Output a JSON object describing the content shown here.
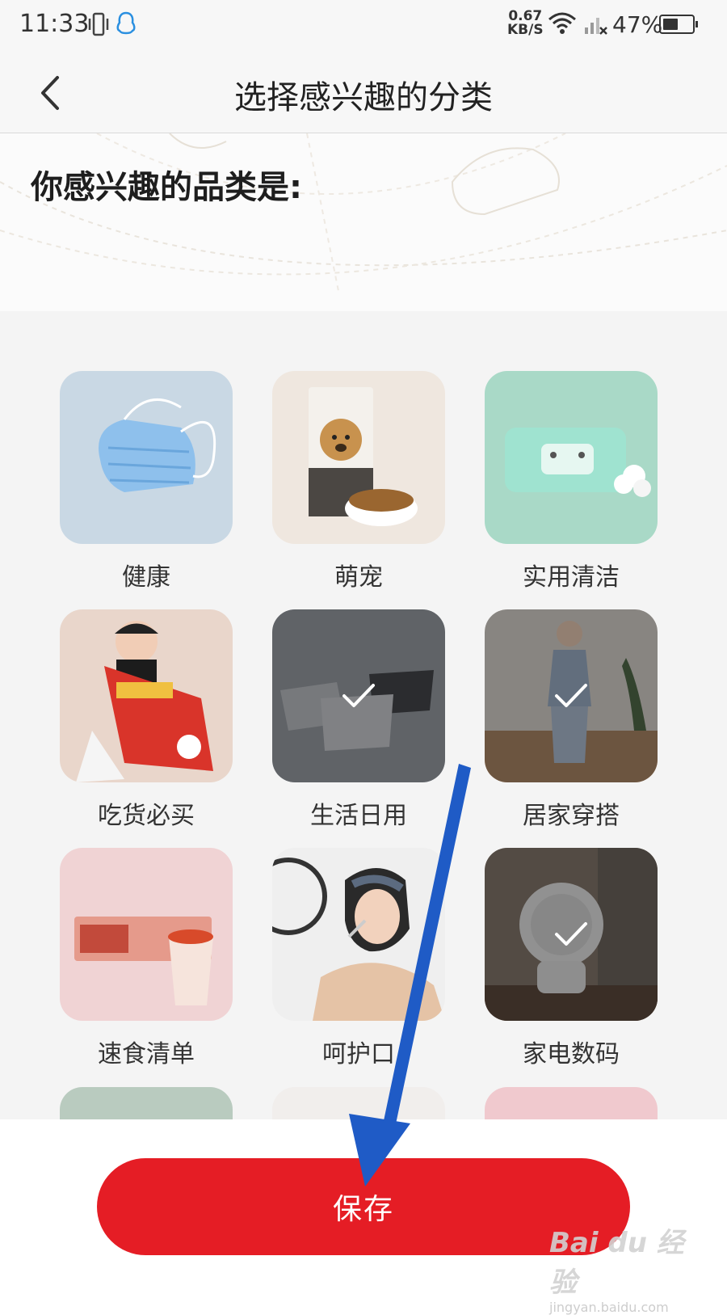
{
  "status_bar": {
    "time": "11:33",
    "speed_value": "0.67",
    "speed_unit": "KB/S",
    "battery": "47%"
  },
  "nav": {
    "title": "选择感兴趣的分类",
    "back_icon": "chevron-left-icon"
  },
  "section": {
    "heading": "你感兴趣的品类是:"
  },
  "categories": [
    {
      "label": "健康",
      "selected": false,
      "icon": "face-mask"
    },
    {
      "label": "萌宠",
      "selected": false,
      "icon": "dog-food-bag"
    },
    {
      "label": "实用清洁",
      "selected": false,
      "icon": "wet-wipes"
    },
    {
      "label": "吃货必买",
      "selected": false,
      "icon": "child-with-snack"
    },
    {
      "label": "生活日用",
      "selected": true,
      "icon": "storage-baskets"
    },
    {
      "label": "居家穿搭",
      "selected": true,
      "icon": "pajamas-woman"
    },
    {
      "label": "速食清单",
      "selected": false,
      "icon": "instant-noodles"
    },
    {
      "label": "呵护口",
      "selected": false,
      "icon": "woman-brushing-teeth"
    },
    {
      "label": "家电数码",
      "selected": true,
      "icon": "desk-fan"
    }
  ],
  "footer": {
    "save_label": "保存"
  },
  "watermark": {
    "logo": "Bai du 经验",
    "url": "jingyan.baidu.com"
  },
  "colors": {
    "accent": "#e51d25",
    "annotation_arrow": "#1f5bc6"
  }
}
